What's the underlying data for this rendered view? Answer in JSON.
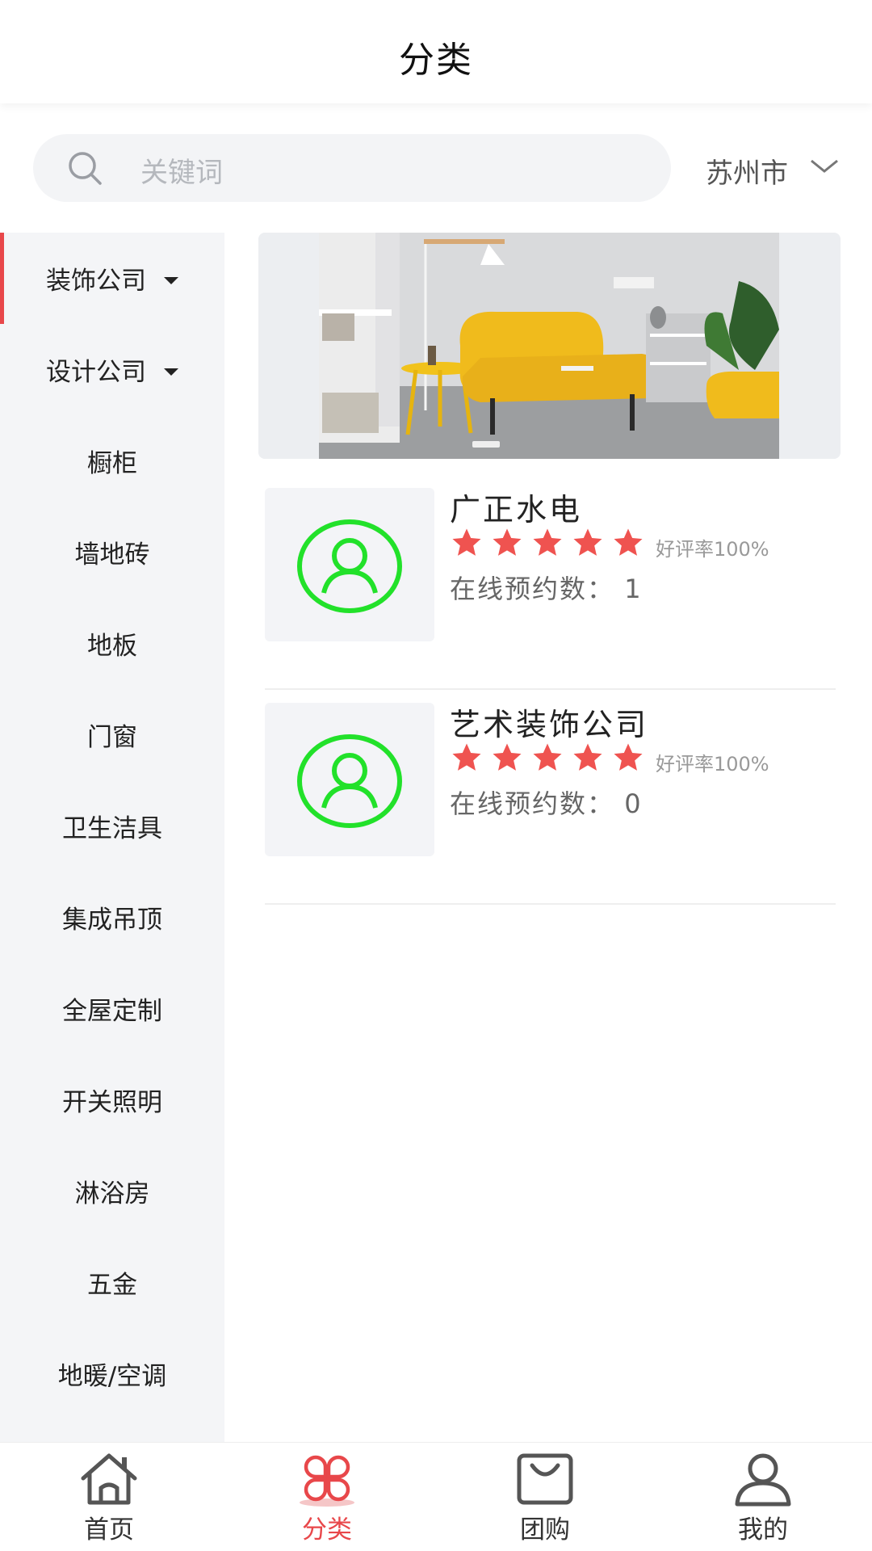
{
  "header": {
    "title": "分类"
  },
  "search": {
    "placeholder": "关键词",
    "icon": "search-icon"
  },
  "location": {
    "city": "苏州市",
    "icon": "chevron-down-icon"
  },
  "sidebar": {
    "active_color": "#e8474a",
    "items": [
      {
        "label": "装饰公司",
        "has_dropdown": true,
        "active": true
      },
      {
        "label": "设计公司",
        "has_dropdown": true,
        "active": false
      },
      {
        "label": "橱柜",
        "has_dropdown": false,
        "active": false
      },
      {
        "label": "墙地砖",
        "has_dropdown": false,
        "active": false
      },
      {
        "label": "地板",
        "has_dropdown": false,
        "active": false
      },
      {
        "label": "门窗",
        "has_dropdown": false,
        "active": false
      },
      {
        "label": "卫生洁具",
        "has_dropdown": false,
        "active": false
      },
      {
        "label": "集成吊顶",
        "has_dropdown": false,
        "active": false
      },
      {
        "label": "全屋定制",
        "has_dropdown": false,
        "active": false
      },
      {
        "label": "开关照明",
        "has_dropdown": false,
        "active": false
      },
      {
        "label": "淋浴房",
        "has_dropdown": false,
        "active": false
      },
      {
        "label": "五金",
        "has_dropdown": false,
        "active": false
      },
      {
        "label": "地暖/空调",
        "has_dropdown": false,
        "active": false
      }
    ]
  },
  "companies": [
    {
      "name": "广正水电",
      "stars": 5,
      "rating_text": "好评率100%",
      "booking_label": "在线预约数：",
      "booking_count": "1"
    },
    {
      "name": "艺术装饰公司",
      "stars": 5,
      "rating_text": "好评率100%",
      "booking_label": "在线预约数：",
      "booking_count": "0"
    }
  ],
  "colors": {
    "star": "#ef5350",
    "avatar": "#22e12a"
  },
  "tabbar": {
    "items": [
      {
        "label": "首页",
        "icon": "home-icon",
        "active": false
      },
      {
        "label": "分类",
        "icon": "category-icon",
        "active": true
      },
      {
        "label": "团购",
        "icon": "shopping-bag-icon",
        "active": false
      },
      {
        "label": "我的",
        "icon": "user-icon",
        "active": false
      }
    ]
  }
}
